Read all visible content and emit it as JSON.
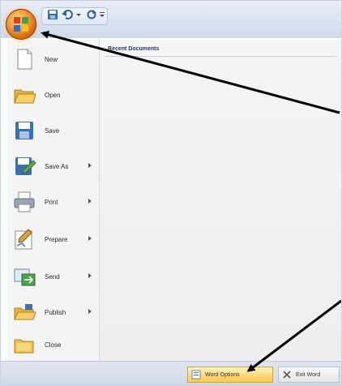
{
  "recent": {
    "title": "Recent Documents"
  },
  "menu": {
    "items": [
      {
        "label": "New",
        "icon": "new-document-icon",
        "submenu": false
      },
      {
        "label": "Open",
        "icon": "open-folder-icon",
        "submenu": false
      },
      {
        "label": "Save",
        "icon": "save-icon",
        "submenu": false
      },
      {
        "label": "Save As",
        "icon": "save-as-icon",
        "submenu": true
      },
      {
        "label": "Print",
        "icon": "printer-icon",
        "submenu": true
      },
      {
        "label": "Prepare",
        "icon": "prepare-icon",
        "submenu": true
      },
      {
        "label": "Send",
        "icon": "send-icon",
        "submenu": true
      },
      {
        "label": "Publish",
        "icon": "publish-icon",
        "submenu": true
      },
      {
        "label": "Close",
        "icon": "close-folder-icon",
        "submenu": false
      }
    ]
  },
  "bottom": {
    "word_options": "Word Options",
    "exit_word": "Exit Word"
  },
  "qat": {
    "icons": [
      "save-icon",
      "undo-icon",
      "redo-icon",
      "customize-qat-icon"
    ]
  },
  "colors": {
    "office_button": "#f6a13a",
    "ribbon": "#d9e3f0",
    "arrow": "#000000"
  }
}
